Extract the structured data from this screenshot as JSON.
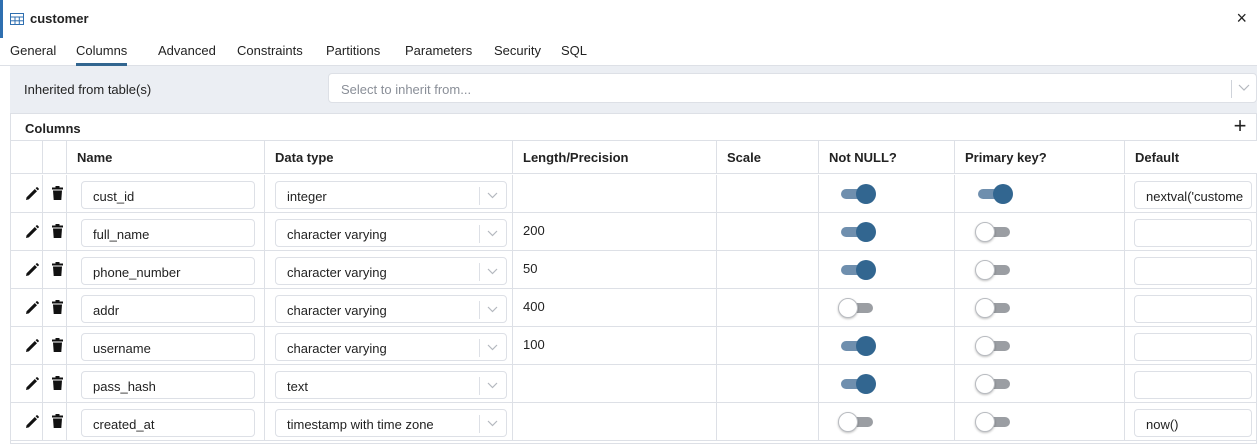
{
  "window": {
    "title": "customer",
    "close_glyph": "×",
    "icon": "table-icon"
  },
  "tabs": [
    {
      "label": "General",
      "active": false
    },
    {
      "label": "Columns",
      "active": true
    },
    {
      "label": "Advanced",
      "active": false
    },
    {
      "label": "Constraints",
      "active": false
    },
    {
      "label": "Partitions",
      "active": false
    },
    {
      "label": "Parameters",
      "active": false
    },
    {
      "label": "Security",
      "active": false
    },
    {
      "label": "SQL",
      "active": false
    }
  ],
  "inherit": {
    "label": "Inherited from table(s)",
    "placeholder": "Select to inherit from..."
  },
  "columns_section": {
    "title": "Columns",
    "add_glyph": "+",
    "headers": [
      "Name",
      "Data type",
      "Length/Precision",
      "Scale",
      "Not NULL?",
      "Primary key?",
      "Default"
    ],
    "rows": [
      {
        "name": "cust_id",
        "data_type": "integer",
        "length": "",
        "scale": "",
        "not_null": true,
        "primary_key": true,
        "default": "nextval('custome"
      },
      {
        "name": "full_name",
        "data_type": "character varying",
        "length": "200",
        "scale": "",
        "not_null": true,
        "primary_key": false,
        "default": ""
      },
      {
        "name": "phone_number",
        "data_type": "character varying",
        "length": "50",
        "scale": "",
        "not_null": true,
        "primary_key": false,
        "default": ""
      },
      {
        "name": "addr",
        "data_type": "character varying",
        "length": "400",
        "scale": "",
        "not_null": false,
        "primary_key": false,
        "default": ""
      },
      {
        "name": "username",
        "data_type": "character varying",
        "length": "100",
        "scale": "",
        "not_null": true,
        "primary_key": false,
        "default": ""
      },
      {
        "name": "pass_hash",
        "data_type": "text",
        "length": "",
        "scale": "",
        "not_null": true,
        "primary_key": false,
        "default": ""
      },
      {
        "name": "created_at",
        "data_type": "timestamp with time zone",
        "length": "",
        "scale": "",
        "not_null": false,
        "primary_key": false,
        "default": "now()"
      }
    ]
  },
  "colors": {
    "accent": "#326690",
    "toggle_on_track": "#6f8fae",
    "toggle_off_track": "#9b9ea3",
    "panel_bg": "#ebeef3",
    "border": "#dde0e6"
  }
}
